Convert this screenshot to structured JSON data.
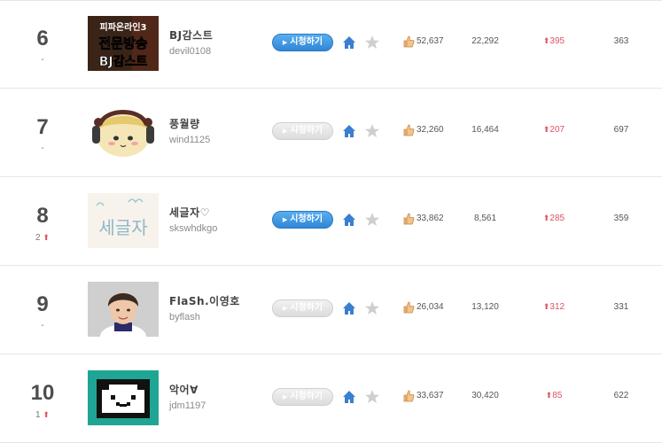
{
  "colors": {
    "accent_blue": "#2f86d6",
    "rank_up_red": "#e05263",
    "text_dark": "#4d4d4d"
  },
  "button_label": "시청하기",
  "rows": [
    {
      "rank": "6",
      "rank_change": "-",
      "name": "BJ감스트",
      "user_id": "devil0108",
      "thumb_text": [
        "피파온라인3",
        "전문방송",
        "BJ감스트"
      ],
      "watch_active": true,
      "likes": "52,637",
      "viewers": "22,292",
      "delta": "395",
      "last": "363"
    },
    {
      "rank": "7",
      "rank_change": "-",
      "name": "풍월량",
      "user_id": "wind1125",
      "watch_active": false,
      "likes": "32,260",
      "viewers": "16,464",
      "delta": "207",
      "last": "697"
    },
    {
      "rank": "8",
      "rank_change": "2",
      "name": "세글자♡",
      "user_id": "skswhdkgo",
      "thumb_text": [
        "세글자"
      ],
      "watch_active": true,
      "likes": "33,862",
      "viewers": "8,561",
      "delta": "285",
      "last": "359"
    },
    {
      "rank": "9",
      "rank_change": "-",
      "name": "FlaSh.이영호",
      "user_id": "byflash",
      "watch_active": false,
      "likes": "26,034",
      "viewers": "13,120",
      "delta": "312",
      "last": "331"
    },
    {
      "rank": "10",
      "rank_change": "1",
      "name": "악어∀",
      "user_id": "jdm1197",
      "watch_active": false,
      "likes": "33,637",
      "viewers": "30,420",
      "delta": "85",
      "last": "622"
    }
  ],
  "icons": {
    "home": "home-icon",
    "favorite": "star-icon",
    "like": "thumbs-up-icon",
    "rank_up": "arrow-up-icon",
    "play": "play-icon"
  }
}
